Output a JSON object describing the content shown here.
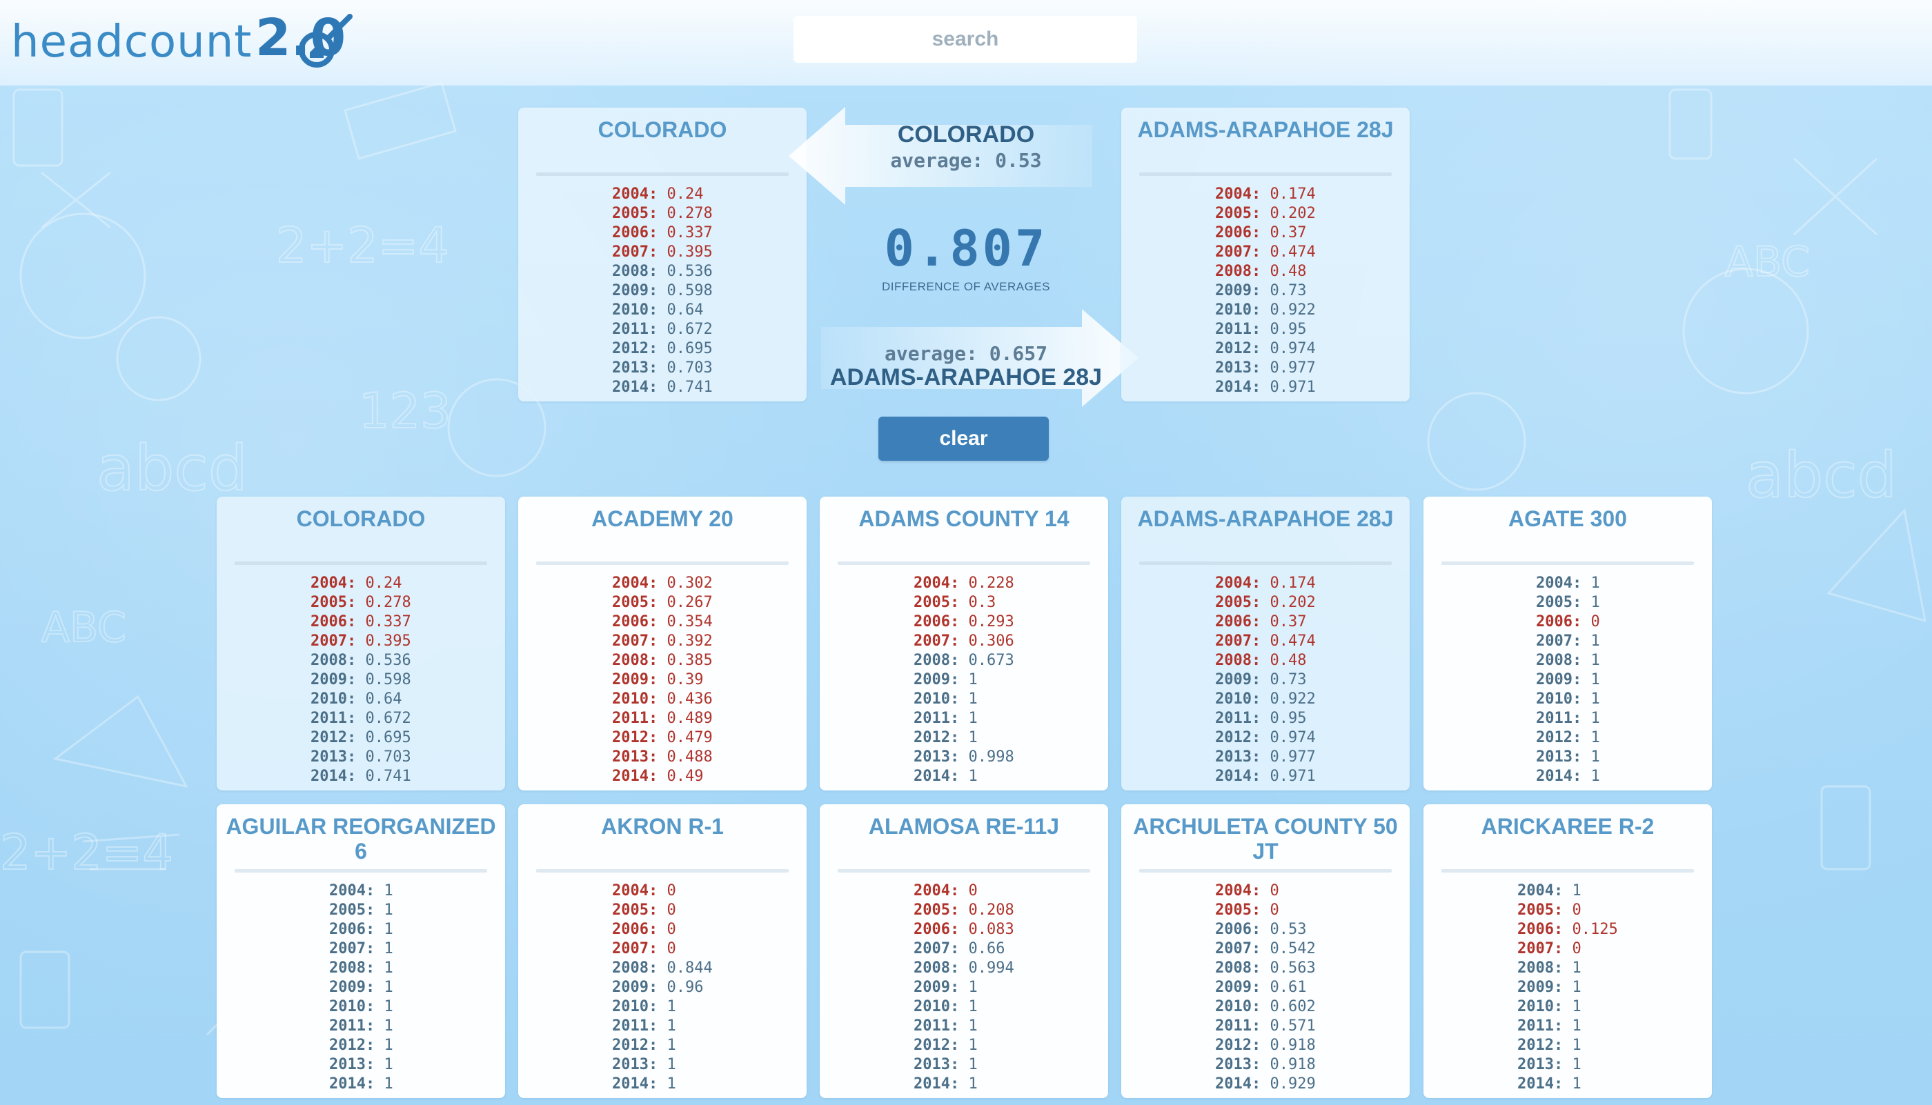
{
  "header": {
    "logo_text": "headcount",
    "logo_version": "2.0",
    "search_placeholder": "search"
  },
  "comparison": {
    "left": {
      "name": "COLORADO",
      "average_label": "average: 0.53",
      "rows": [
        {
          "year": "2004:",
          "value": "0.24",
          "low": true
        },
        {
          "year": "2005:",
          "value": "0.278",
          "low": true
        },
        {
          "year": "2006:",
          "value": "0.337",
          "low": true
        },
        {
          "year": "2007:",
          "value": "0.395",
          "low": true
        },
        {
          "year": "2008:",
          "value": "0.536",
          "low": false
        },
        {
          "year": "2009:",
          "value": "0.598",
          "low": false
        },
        {
          "year": "2010:",
          "value": "0.64",
          "low": false
        },
        {
          "year": "2011:",
          "value": "0.672",
          "low": false
        },
        {
          "year": "2012:",
          "value": "0.695",
          "low": false
        },
        {
          "year": "2013:",
          "value": "0.703",
          "low": false
        },
        {
          "year": "2014:",
          "value": "0.741",
          "low": false
        }
      ]
    },
    "right": {
      "name": "ADAMS-ARAPAHOE 28J",
      "average_label": "average: 0.657",
      "rows": [
        {
          "year": "2004:",
          "value": "0.174",
          "low": true
        },
        {
          "year": "2005:",
          "value": "0.202",
          "low": true
        },
        {
          "year": "2006:",
          "value": "0.37",
          "low": true
        },
        {
          "year": "2007:",
          "value": "0.474",
          "low": true
        },
        {
          "year": "2008:",
          "value": "0.48",
          "low": true
        },
        {
          "year": "2009:",
          "value": "0.73",
          "low": false
        },
        {
          "year": "2010:",
          "value": "0.922",
          "low": false
        },
        {
          "year": "2011:",
          "value": "0.95",
          "low": false
        },
        {
          "year": "2012:",
          "value": "0.974",
          "low": false
        },
        {
          "year": "2013:",
          "value": "0.977",
          "low": false
        },
        {
          "year": "2014:",
          "value": "0.971",
          "low": false
        }
      ]
    },
    "difference_value": "0.807",
    "difference_label": "DIFFERENCE OF AVERAGES",
    "clear_label": "clear"
  },
  "districts": [
    {
      "name": "COLORADO",
      "selected": true,
      "rows": [
        {
          "year": "2004:",
          "value": "0.24",
          "low": true
        },
        {
          "year": "2005:",
          "value": "0.278",
          "low": true
        },
        {
          "year": "2006:",
          "value": "0.337",
          "low": true
        },
        {
          "year": "2007:",
          "value": "0.395",
          "low": true
        },
        {
          "year": "2008:",
          "value": "0.536",
          "low": false
        },
        {
          "year": "2009:",
          "value": "0.598",
          "low": false
        },
        {
          "year": "2010:",
          "value": "0.64",
          "low": false
        },
        {
          "year": "2011:",
          "value": "0.672",
          "low": false
        },
        {
          "year": "2012:",
          "value": "0.695",
          "low": false
        },
        {
          "year": "2013:",
          "value": "0.703",
          "low": false
        },
        {
          "year": "2014:",
          "value": "0.741",
          "low": false
        }
      ]
    },
    {
      "name": "ACADEMY 20",
      "selected": false,
      "rows": [
        {
          "year": "2004:",
          "value": "0.302",
          "low": true
        },
        {
          "year": "2005:",
          "value": "0.267",
          "low": true
        },
        {
          "year": "2006:",
          "value": "0.354",
          "low": true
        },
        {
          "year": "2007:",
          "value": "0.392",
          "low": true
        },
        {
          "year": "2008:",
          "value": "0.385",
          "low": true
        },
        {
          "year": "2009:",
          "value": "0.39",
          "low": true
        },
        {
          "year": "2010:",
          "value": "0.436",
          "low": true
        },
        {
          "year": "2011:",
          "value": "0.489",
          "low": true
        },
        {
          "year": "2012:",
          "value": "0.479",
          "low": true
        },
        {
          "year": "2013:",
          "value": "0.488",
          "low": true
        },
        {
          "year": "2014:",
          "value": "0.49",
          "low": true
        }
      ]
    },
    {
      "name": "ADAMS COUNTY 14",
      "selected": false,
      "rows": [
        {
          "year": "2004:",
          "value": "0.228",
          "low": true
        },
        {
          "year": "2005:",
          "value": "0.3",
          "low": true
        },
        {
          "year": "2006:",
          "value": "0.293",
          "low": true
        },
        {
          "year": "2007:",
          "value": "0.306",
          "low": true
        },
        {
          "year": "2008:",
          "value": "0.673",
          "low": false
        },
        {
          "year": "2009:",
          "value": "1",
          "low": false
        },
        {
          "year": "2010:",
          "value": "1",
          "low": false
        },
        {
          "year": "2011:",
          "value": "1",
          "low": false
        },
        {
          "year": "2012:",
          "value": "1",
          "low": false
        },
        {
          "year": "2013:",
          "value": "0.998",
          "low": false
        },
        {
          "year": "2014:",
          "value": "1",
          "low": false
        }
      ]
    },
    {
      "name": "ADAMS-ARAPAHOE 28J",
      "selected": true,
      "rows": [
        {
          "year": "2004:",
          "value": "0.174",
          "low": true
        },
        {
          "year": "2005:",
          "value": "0.202",
          "low": true
        },
        {
          "year": "2006:",
          "value": "0.37",
          "low": true
        },
        {
          "year": "2007:",
          "value": "0.474",
          "low": true
        },
        {
          "year": "2008:",
          "value": "0.48",
          "low": true
        },
        {
          "year": "2009:",
          "value": "0.73",
          "low": false
        },
        {
          "year": "2010:",
          "value": "0.922",
          "low": false
        },
        {
          "year": "2011:",
          "value": "0.95",
          "low": false
        },
        {
          "year": "2012:",
          "value": "0.974",
          "low": false
        },
        {
          "year": "2013:",
          "value": "0.977",
          "low": false
        },
        {
          "year": "2014:",
          "value": "0.971",
          "low": false
        }
      ]
    },
    {
      "name": "AGATE 300",
      "selected": false,
      "rows": [
        {
          "year": "2004:",
          "value": "1",
          "low": false
        },
        {
          "year": "2005:",
          "value": "1",
          "low": false
        },
        {
          "year": "2006:",
          "value": "0",
          "low": true
        },
        {
          "year": "2007:",
          "value": "1",
          "low": false
        },
        {
          "year": "2008:",
          "value": "1",
          "low": false
        },
        {
          "year": "2009:",
          "value": "1",
          "low": false
        },
        {
          "year": "2010:",
          "value": "1",
          "low": false
        },
        {
          "year": "2011:",
          "value": "1",
          "low": false
        },
        {
          "year": "2012:",
          "value": "1",
          "low": false
        },
        {
          "year": "2013:",
          "value": "1",
          "low": false
        },
        {
          "year": "2014:",
          "value": "1",
          "low": false
        }
      ]
    },
    {
      "name": "AGUILAR REORGANIZED 6",
      "selected": false,
      "rows": [
        {
          "year": "2004:",
          "value": "1",
          "low": false
        },
        {
          "year": "2005:",
          "value": "1",
          "low": false
        },
        {
          "year": "2006:",
          "value": "1",
          "low": false
        },
        {
          "year": "2007:",
          "value": "1",
          "low": false
        },
        {
          "year": "2008:",
          "value": "1",
          "low": false
        },
        {
          "year": "2009:",
          "value": "1",
          "low": false
        },
        {
          "year": "2010:",
          "value": "1",
          "low": false
        },
        {
          "year": "2011:",
          "value": "1",
          "low": false
        },
        {
          "year": "2012:",
          "value": "1",
          "low": false
        },
        {
          "year": "2013:",
          "value": "1",
          "low": false
        },
        {
          "year": "2014:",
          "value": "1",
          "low": false
        }
      ]
    },
    {
      "name": "AKRON R-1",
      "selected": false,
      "rows": [
        {
          "year": "2004:",
          "value": "0",
          "low": true
        },
        {
          "year": "2005:",
          "value": "0",
          "low": true
        },
        {
          "year": "2006:",
          "value": "0",
          "low": true
        },
        {
          "year": "2007:",
          "value": "0",
          "low": true
        },
        {
          "year": "2008:",
          "value": "0.844",
          "low": false
        },
        {
          "year": "2009:",
          "value": "0.96",
          "low": false
        },
        {
          "year": "2010:",
          "value": "1",
          "low": false
        },
        {
          "year": "2011:",
          "value": "1",
          "low": false
        },
        {
          "year": "2012:",
          "value": "1",
          "low": false
        },
        {
          "year": "2013:",
          "value": "1",
          "low": false
        },
        {
          "year": "2014:",
          "value": "1",
          "low": false
        }
      ]
    },
    {
      "name": "ALAMOSA RE-11J",
      "selected": false,
      "rows": [
        {
          "year": "2004:",
          "value": "0",
          "low": true
        },
        {
          "year": "2005:",
          "value": "0.208",
          "low": true
        },
        {
          "year": "2006:",
          "value": "0.083",
          "low": true
        },
        {
          "year": "2007:",
          "value": "0.66",
          "low": false
        },
        {
          "year": "2008:",
          "value": "0.994",
          "low": false
        },
        {
          "year": "2009:",
          "value": "1",
          "low": false
        },
        {
          "year": "2010:",
          "value": "1",
          "low": false
        },
        {
          "year": "2011:",
          "value": "1",
          "low": false
        },
        {
          "year": "2012:",
          "value": "1",
          "low": false
        },
        {
          "year": "2013:",
          "value": "1",
          "low": false
        },
        {
          "year": "2014:",
          "value": "1",
          "low": false
        }
      ]
    },
    {
      "name": "ARCHULETA COUNTY 50 JT",
      "selected": false,
      "rows": [
        {
          "year": "2004:",
          "value": "0",
          "low": true
        },
        {
          "year": "2005:",
          "value": "0",
          "low": true
        },
        {
          "year": "2006:",
          "value": "0.53",
          "low": false
        },
        {
          "year": "2007:",
          "value": "0.542",
          "low": false
        },
        {
          "year": "2008:",
          "value": "0.563",
          "low": false
        },
        {
          "year": "2009:",
          "value": "0.61",
          "low": false
        },
        {
          "year": "2010:",
          "value": "0.602",
          "low": false
        },
        {
          "year": "2011:",
          "value": "0.571",
          "low": false
        },
        {
          "year": "2012:",
          "value": "0.918",
          "low": false
        },
        {
          "year": "2013:",
          "value": "0.918",
          "low": false
        },
        {
          "year": "2014:",
          "value": "0.929",
          "low": false
        }
      ]
    },
    {
      "name": "ARICKAREE R-2",
      "selected": false,
      "rows": [
        {
          "year": "2004:",
          "value": "1",
          "low": false
        },
        {
          "year": "2005:",
          "value": "0",
          "low": true
        },
        {
          "year": "2006:",
          "value": "0.125",
          "low": true
        },
        {
          "year": "2007:",
          "value": "0",
          "low": true
        },
        {
          "year": "2008:",
          "value": "1",
          "low": false
        },
        {
          "year": "2009:",
          "value": "1",
          "low": false
        },
        {
          "year": "2010:",
          "value": "1",
          "low": false
        },
        {
          "year": "2011:",
          "value": "1",
          "low": false
        },
        {
          "year": "2012:",
          "value": "1",
          "low": false
        },
        {
          "year": "2013:",
          "value": "1",
          "low": false
        },
        {
          "year": "2014:",
          "value": "1",
          "low": false
        }
      ]
    }
  ]
}
